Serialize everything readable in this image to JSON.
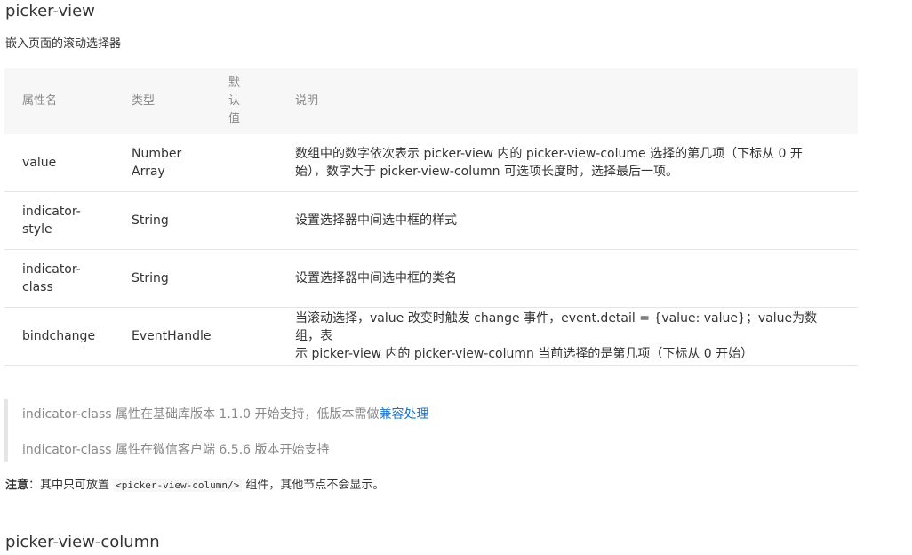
{
  "title": "picker-view",
  "intro": "嵌入页面的滚动选择器",
  "table": {
    "headers": {
      "name": "属性名",
      "type": "类型",
      "default": [
        "默",
        "认",
        "值"
      ],
      "desc": "说明"
    },
    "rows": [
      {
        "name": "value",
        "type_lines": [
          "Number",
          "Array"
        ],
        "default": "",
        "desc_lines": [
          "数组中的数字依次表示 picker-view 内的 picker-view-colume 选择的第几项（下标从 0 开",
          "始），数字大于 picker-view-column 可选项长度时，选择最后一项。"
        ]
      },
      {
        "name_lines": [
          "indicator-",
          "style"
        ],
        "type": "String",
        "default": "",
        "desc": "设置选择器中间选中框的样式"
      },
      {
        "name_lines": [
          "indicator-",
          "class"
        ],
        "type": "String",
        "default": "",
        "desc": "设置选择器中间选中框的类名"
      },
      {
        "name": "bindchange",
        "type": "EventHandle",
        "default": "",
        "desc_lines": [
          "当滚动选择，value 改变时触发 change 事件，event.detail = {value: value}；value为数组，表",
          "示 picker-view 内的 picker-view-column 当前选择的是第几项（下标从 0 开始）"
        ]
      }
    ]
  },
  "notes": {
    "note1_text": "indicator-class 属性在基础库版本 1.1.0 开始支持，低版本需做",
    "note1_link": "兼容处理",
    "note2_text": "indicator-class 属性在微信客户端 6.5.6 版本开始支持"
  },
  "warning": {
    "label": "注意",
    "colon": "：其中只可放置 ",
    "code": "<picker-view-column/>",
    "rest": " 组件，其他节点不会显示。"
  },
  "next_title": "picker-view-column",
  "colors": {
    "link": "#1a73c8",
    "header_bg": "#f7f7f7",
    "muted": "#888888",
    "border": "#e5e5e5"
  }
}
